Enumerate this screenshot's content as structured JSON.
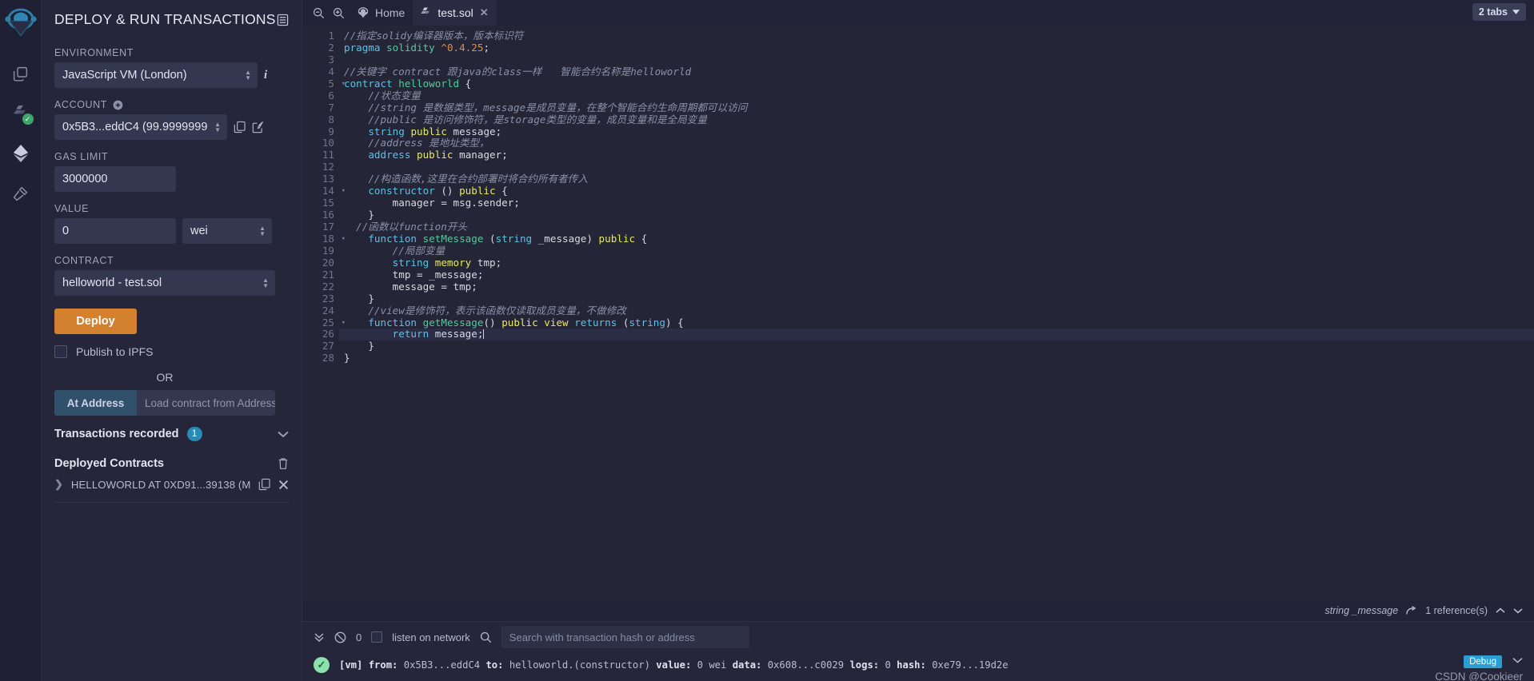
{
  "rail": {
    "logo_name": "remix-logo",
    "items": [
      {
        "name": "file-explorer-icon",
        "label": "File explorers"
      },
      {
        "name": "solidity-compiler-icon",
        "label": "Solidity compiler"
      },
      {
        "name": "deploy-run-icon",
        "label": "Deploy & run transactions"
      },
      {
        "name": "plugin-manager-icon",
        "label": "Plugin manager"
      }
    ]
  },
  "panel": {
    "title": "DEPLOY & RUN TRANSACTIONS",
    "header_icon": "list-icon",
    "environment": {
      "label": "ENVIRONMENT",
      "value": "JavaScript VM (London)",
      "info_icon": "info-icon"
    },
    "account": {
      "label": "ACCOUNT",
      "add_icon": "plus-circle-icon",
      "value": "0x5B3...eddC4 (99.9999999",
      "copy_icon": "copy-icon",
      "edit_icon": "edit-icon"
    },
    "gas_limit": {
      "label": "GAS LIMIT",
      "value": "3000000"
    },
    "value": {
      "label": "VALUE",
      "amount": "0",
      "unit": "wei"
    },
    "contract": {
      "label": "CONTRACT",
      "value": "helloworld - test.sol"
    },
    "deploy_label": "Deploy",
    "publish_ipfs_label": "Publish to IPFS",
    "publish_ipfs_checked": false,
    "or_label": "OR",
    "at_address_label": "At Address",
    "at_address_placeholder": "Load contract from Address",
    "transactions_recorded": {
      "label": "Transactions recorded",
      "count": "1",
      "chevron": "chevron-down-icon"
    },
    "deployed_contracts": {
      "label": "Deployed Contracts",
      "trash_icon": "trash-icon"
    },
    "deployed_item": {
      "expand_icon": "chevron-right-icon",
      "label": "HELLOWORLD AT 0XD91...39138 (M",
      "copy_icon": "copy-icon",
      "close_icon": "close-icon"
    }
  },
  "tabbar": {
    "zoom_out_icon": "zoom-out-icon",
    "zoom_in_icon": "zoom-in-icon",
    "home_icon": "remix-home-icon",
    "home_label": "Home",
    "file_icon": "solidity-file-icon",
    "file_label": "test.sol",
    "close_icon": "close-icon",
    "tabs_count_label": "2 tabs",
    "tabs_caret_icon": "chevron-down-icon"
  },
  "editor": {
    "current_line": 26,
    "lines": [
      {
        "n": 1,
        "fold": false
      },
      {
        "n": 2,
        "fold": false
      },
      {
        "n": 3,
        "fold": false
      },
      {
        "n": 4,
        "fold": false
      },
      {
        "n": 5,
        "fold": true
      },
      {
        "n": 6,
        "fold": false
      },
      {
        "n": 7,
        "fold": false
      },
      {
        "n": 8,
        "fold": false
      },
      {
        "n": 9,
        "fold": false
      },
      {
        "n": 10,
        "fold": false
      },
      {
        "n": 11,
        "fold": false
      },
      {
        "n": 12,
        "fold": false
      },
      {
        "n": 13,
        "fold": false
      },
      {
        "n": 14,
        "fold": true
      },
      {
        "n": 15,
        "fold": false
      },
      {
        "n": 16,
        "fold": false
      },
      {
        "n": 17,
        "fold": false
      },
      {
        "n": 18,
        "fold": true
      },
      {
        "n": 19,
        "fold": false
      },
      {
        "n": 20,
        "fold": false
      },
      {
        "n": 21,
        "fold": false
      },
      {
        "n": 22,
        "fold": false
      },
      {
        "n": 23,
        "fold": false
      },
      {
        "n": 24,
        "fold": false
      },
      {
        "n": 25,
        "fold": true
      },
      {
        "n": 26,
        "fold": false
      },
      {
        "n": 27,
        "fold": false
      },
      {
        "n": 28,
        "fold": false
      }
    ],
    "source": [
      "//指定solidy编译器版本，版本标识符",
      "pragma solidity ^0.4.25;",
      "",
      "//关键字 contract 跟java的class一样   智能合约名称是helloworld",
      "contract helloworld {",
      "    //状态变量",
      "    //string 是数据类型，message是成员变量，在整个智能合约生命周期都可以访问",
      "    //public 是访问修饰符，是storage类型的变量，成员变量和是全局变量",
      "    string public message;",
      "    //address 是地址类型，",
      "    address public manager;",
      "",
      "    //构造函数,这里在合约部署时将合约所有者传入",
      "    constructor () public {",
      "        manager = msg.sender;",
      "    }",
      "  //函数以function开头",
      "    function setMessage (string _message) public {",
      "        //局部变量",
      "        string memory tmp;",
      "        tmp = _message;",
      "        message = tmp;",
      "    }",
      "    //view是修饰符，表示该函数仅读取成员变量，不做修改",
      "    function getMessage() public view returns (string) {",
      "        return message;",
      "    }",
      "}"
    ],
    "status": {
      "signature": "string _message",
      "goto_icon": "go-to-reference-icon",
      "references": "1 reference(s)",
      "up_icon": "chevron-up-icon",
      "down_icon": "chevron-down-icon"
    }
  },
  "terminal": {
    "collapse_icon": "double-chevron-down-icon",
    "clear_icon": "clear-console-icon",
    "pending_count": "0",
    "listen_label": "listen on network",
    "listen_checked": false,
    "search_icon": "search-icon",
    "search_placeholder": "Search with transaction hash or address",
    "log": {
      "status_icon": "check-circle-icon",
      "vm_tag": "[vm]",
      "from_label": "from:",
      "from_value": "0x5B3...eddC4",
      "to_label": "to:",
      "to_value": "helloworld.(constructor)",
      "value_label": "value:",
      "value_value": "0 wei",
      "data_label": "data:",
      "data_value": "0x608...c0029",
      "logs_label": "logs:",
      "logs_value": "0",
      "hash_label": "hash:",
      "hash_value": "0xe79...19d2e",
      "debug_label": "Debug",
      "expand_icon": "chevron-down-icon"
    },
    "watermark": "CSDN @Cookieer"
  },
  "colors": {
    "accent_orange": "#d3802f",
    "accent_blue": "#2a8ab5",
    "panel_bg": "#252639",
    "editor_bg": "#242536",
    "success_green": "#8ee0ae"
  }
}
